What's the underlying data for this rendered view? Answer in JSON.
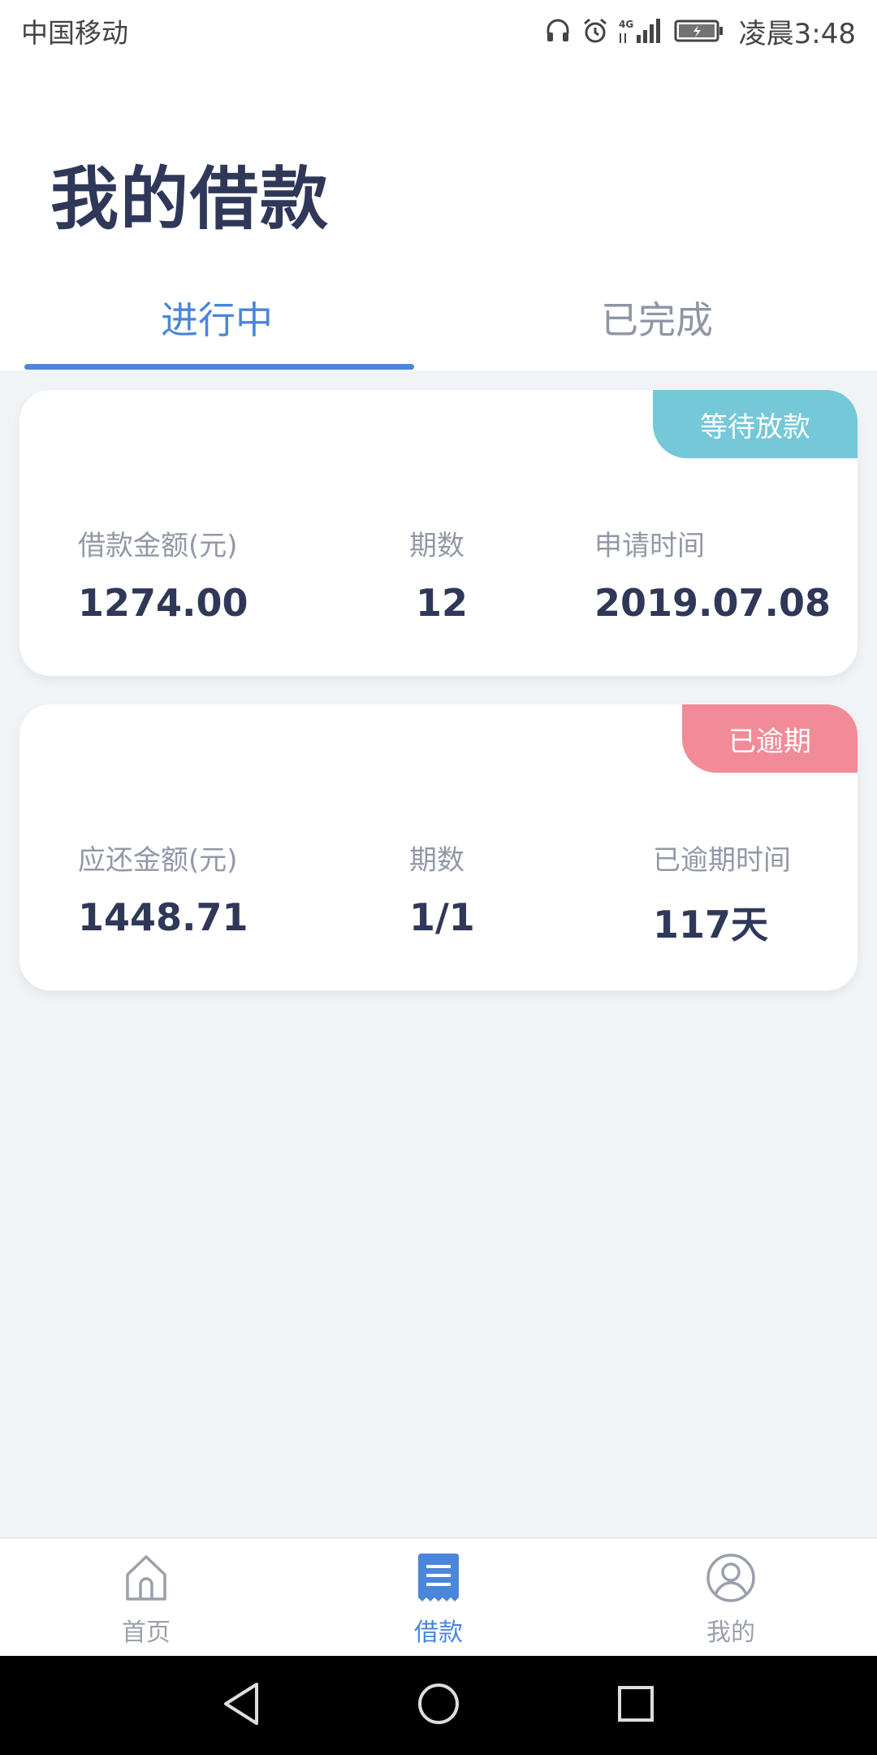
{
  "status_bar": {
    "carrier": "中国移动",
    "time": "凌晨3:48",
    "network": "4G",
    "icons": [
      "headset-icon",
      "alarm-icon",
      "signal-icon",
      "battery-icon"
    ]
  },
  "header": {
    "title": "我的借款"
  },
  "tabs": [
    {
      "label": "进行中",
      "active": true
    },
    {
      "label": "已完成",
      "active": false
    }
  ],
  "loans": [
    {
      "status": "等待放款",
      "status_color": "#74c8d8",
      "fields": [
        {
          "label": "借款金额(元)",
          "value": "1274.00"
        },
        {
          "label": "期数",
          "value": "12"
        },
        {
          "label": "申请时间",
          "value": "2019.07.08"
        }
      ]
    },
    {
      "status": "已逾期",
      "status_color": "#f28b98",
      "fields": [
        {
          "label": "应还金额(元)",
          "value": "1448.71"
        },
        {
          "label": "期数",
          "value": "1/1"
        },
        {
          "label": "已逾期时间",
          "value": "117天"
        }
      ]
    }
  ],
  "bottom_nav": [
    {
      "label": "首页",
      "icon": "home-icon",
      "active": false
    },
    {
      "label": "借款",
      "icon": "loan-document-icon",
      "active": true
    },
    {
      "label": "我的",
      "icon": "profile-icon",
      "active": false
    }
  ],
  "colors": {
    "accent": "#4a86d9",
    "title": "#2f3858",
    "muted": "#9298a6",
    "background": "#f1f4f7"
  }
}
